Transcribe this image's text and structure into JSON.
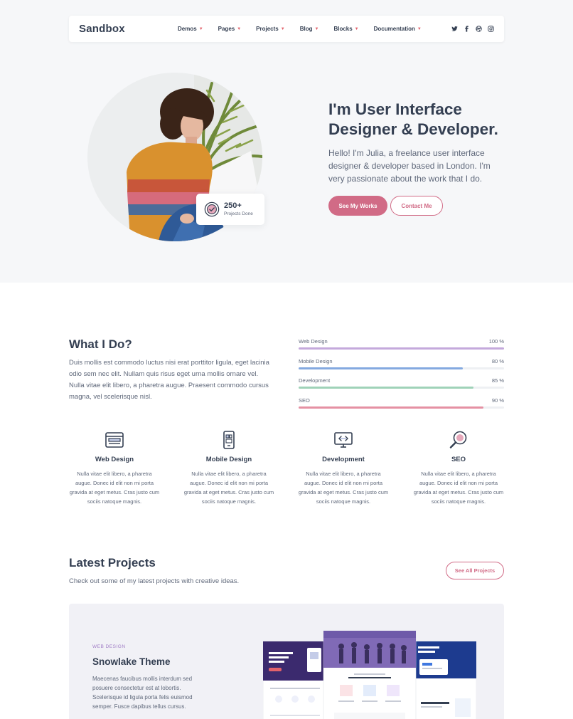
{
  "nav": {
    "brand": "Sandbox",
    "items": [
      {
        "label": "Demos"
      },
      {
        "label": "Pages"
      },
      {
        "label": "Projects"
      },
      {
        "label": "Blog"
      },
      {
        "label": "Blocks"
      },
      {
        "label": "Documentation"
      }
    ],
    "socials": [
      "twitter-icon",
      "facebook-icon",
      "dribbble-icon",
      "instagram-icon"
    ]
  },
  "hero": {
    "title_line1": "I'm User Interface",
    "title_line2": "Designer & Developer.",
    "lead": "Hello! I'm Julia, a freelance user interface designer & developer based in London. I'm very passionate about the work that I do.",
    "primary_button": "See My Works",
    "secondary_button": "Contact Me",
    "stat": {
      "value": "250+",
      "label": "Projects Done"
    }
  },
  "what_i_do": {
    "title": "What I Do?",
    "text": "Duis mollis est commodo luctus nisi erat porttitor ligula, eget lacinia odio sem nec elit. Nullam quis risus eget urna mollis ornare vel. Nulla vitae elit libero, a pharetra augue. Praesent commodo cursus magna, vel scelerisque nisl.",
    "skills": [
      {
        "name": "Web Design",
        "percent_label": "100 %",
        "value": 100,
        "color": "#c4a9dc"
      },
      {
        "name": "Mobile Design",
        "percent_label": "80 %",
        "value": 80,
        "color": "#84a9e0"
      },
      {
        "name": "Development",
        "percent_label": "85 %",
        "value": 85,
        "color": "#9fd2b8"
      },
      {
        "name": "SEO",
        "percent_label": "90 %",
        "value": 90,
        "color": "#e591a3"
      }
    ],
    "services": [
      {
        "title": "Web Design",
        "icon": "browser-icon",
        "text": "Nulla vitae elit libero, a pharetra augue. Donec id elit non mi porta gravida at eget metus. Cras justo cum sociis natoque magnis."
      },
      {
        "title": "Mobile Design",
        "icon": "smartphone-icon",
        "text": "Nulla vitae elit libero, a pharetra augue. Donec id elit non mi porta gravida at eget metus. Cras justo cum sociis natoque magnis."
      },
      {
        "title": "Development",
        "icon": "monitor-code-icon",
        "text": "Nulla vitae elit libero, a pharetra augue. Donec id elit non mi porta gravida at eget metus. Cras justo cum sociis natoque magnis."
      },
      {
        "title": "SEO",
        "icon": "search-icon",
        "text": "Nulla vitae elit libero, a pharetra augue. Donec id elit non mi porta gravida at eget metus. Cras justo cum sociis natoque magnis."
      }
    ]
  },
  "projects": {
    "title": "Latest Projects",
    "subtitle": "Check out some of my latest projects with creative ideas.",
    "see_all": "See All Projects",
    "featured": {
      "category": "WEB DESIGN",
      "name": "Snowlake Theme",
      "description": "Maecenas faucibus mollis interdum sed posuere consectetur est at lobortis. Scelerisque id ligula porta felis euismod semper. Fusce dapibus tellus cursus."
    }
  },
  "colors": {
    "accent": "#d16b86",
    "heading": "#343f52",
    "body": "#60697b",
    "hero_bg": "#f6f7f9"
  }
}
